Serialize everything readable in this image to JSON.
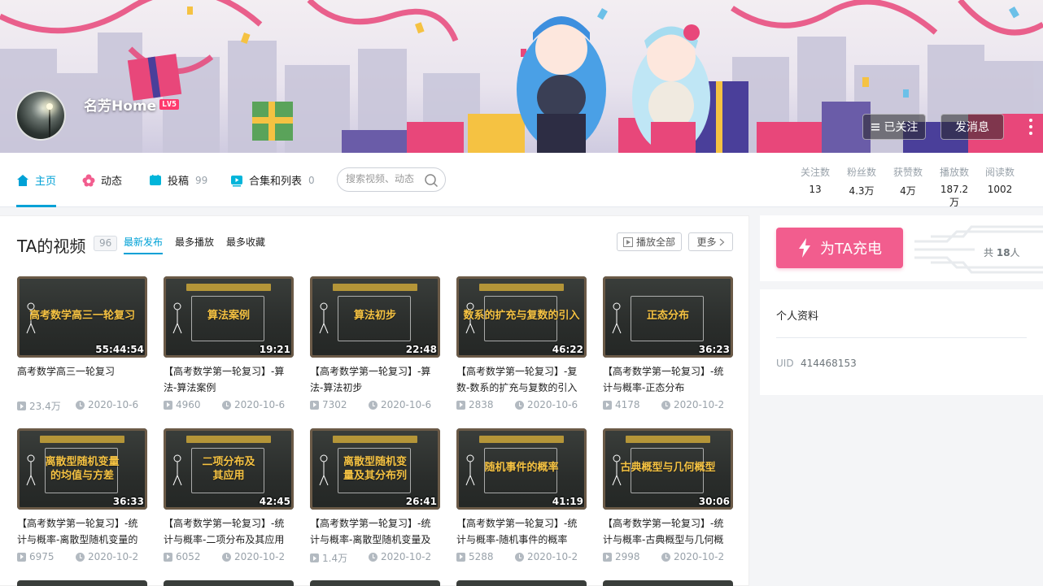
{
  "banner": {
    "username": "名芳Home",
    "level": "LV5",
    "follow_label": "已关注",
    "message_label": "发消息"
  },
  "nav": {
    "items": [
      {
        "label": "主页",
        "count": ""
      },
      {
        "label": "动态",
        "count": ""
      },
      {
        "label": "投稿",
        "count": "99"
      },
      {
        "label": "合集和列表",
        "count": "0"
      }
    ],
    "search_placeholder": "搜索视频、动态"
  },
  "stats": [
    {
      "label": "关注数",
      "value": "13"
    },
    {
      "label": "粉丝数",
      "value": "4.3万"
    },
    {
      "label": "获赞数",
      "value": "4万"
    },
    {
      "label": "播放数",
      "value": "187.2万"
    },
    {
      "label": "阅读数",
      "value": "1002"
    }
  ],
  "videos_section": {
    "title": "TA的视频",
    "count": "96",
    "filters": [
      "最新发布",
      "最多播放",
      "最多收藏"
    ],
    "play_all_label": "播放全部",
    "more_label": "更多"
  },
  "videos": [
    {
      "thumb": "高考数学高三一轮复习",
      "duration": "55:44:54",
      "title": "高考数学高三一轮复习",
      "plays": "23.4万",
      "date": "2020-10-6"
    },
    {
      "thumb": "算法案例",
      "duration": "19:21",
      "title": "【高考数学第一轮复习】-算法-算法案例",
      "plays": "4960",
      "date": "2020-10-6"
    },
    {
      "thumb": "算法初步",
      "duration": "22:48",
      "title": "【高考数学第一轮复习】-算法-算法初步",
      "plays": "7302",
      "date": "2020-10-6"
    },
    {
      "thumb": "数系的扩充与复数的引入",
      "duration": "46:22",
      "title": "【高考数学第一轮复习】-复数-数系的扩充与复数的引入",
      "plays": "2838",
      "date": "2020-10-6"
    },
    {
      "thumb": "正态分布",
      "duration": "36:23",
      "title": "【高考数学第一轮复习】-统计与概率-正态分布",
      "plays": "4178",
      "date": "2020-10-2"
    },
    {
      "thumb": "离散型随机变量的均值与方差",
      "duration": "36:33",
      "title": "【高考数学第一轮复习】-统计与概率-离散型随机变量的",
      "plays": "6975",
      "date": "2020-10-2"
    },
    {
      "thumb": "二项分布及其应用",
      "duration": "42:45",
      "title": "【高考数学第一轮复习】-统计与概率-二项分布及其应用",
      "plays": "6052",
      "date": "2020-10-2"
    },
    {
      "thumb": "离散型随机变量及其分布列",
      "duration": "26:41",
      "title": "【高考数学第一轮复习】-统计与概率-离散型随机变量及",
      "plays": "1.4万",
      "date": "2020-10-2"
    },
    {
      "thumb": "随机事件的概率",
      "duration": "41:19",
      "title": "【高考数学第一轮复习】-统计与概率-随机事件的概率",
      "plays": "5288",
      "date": "2020-10-2"
    },
    {
      "thumb": "古典概型与几何概型",
      "duration": "30:06",
      "title": "【高考数学第一轮复习】-统计与概率-古典概型与几何概",
      "plays": "2998",
      "date": "2020-10-2"
    }
  ],
  "charge": {
    "button_label": "为TA充电",
    "count_prefix": "共",
    "count": "18",
    "count_suffix": "人"
  },
  "profile": {
    "title": "个人资料",
    "uid_label": "UID",
    "uid_value": "414468153"
  },
  "colors": {
    "accent": "#00a1d6",
    "charge": "#f25d8e",
    "muted": "#99a2aa"
  }
}
